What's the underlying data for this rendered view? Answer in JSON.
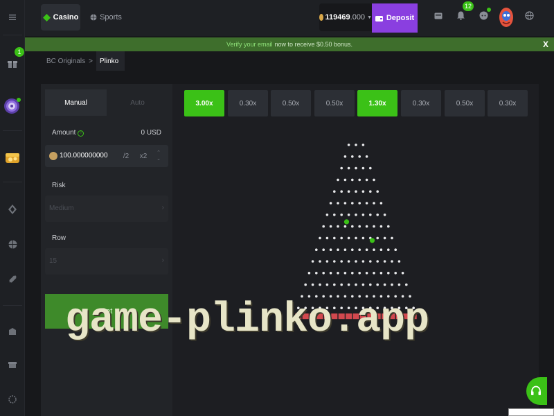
{
  "topbar": {
    "casino_label": "Casino",
    "sports_label": "Sports",
    "balance_main": "119469",
    "balance_decimal": ".000",
    "deposit_label": "Deposit",
    "notification_count": "12"
  },
  "rail": {
    "gift_badge": "1"
  },
  "banner": {
    "highlight": "Verify your email",
    "text": "now to receive $0.50 bonus.",
    "close_label": "X"
  },
  "breadcrumb": {
    "root": "BC Originals",
    "separator": ">",
    "current": "Plinko"
  },
  "controls": {
    "mode_manual": "Manual",
    "mode_auto": "Auto",
    "amount_label": "Amount",
    "amount_info": "!",
    "amount_usd": "0 USD",
    "amount_value": "100.000000000",
    "half_label": "/2",
    "double_label": "x2",
    "risk_label": "Risk",
    "risk_value": "Medium",
    "row_label": "Row",
    "row_value": "15",
    "bet_label": "Bet"
  },
  "multipliers": [
    {
      "label": "3.00x",
      "active": true
    },
    {
      "label": "0.30x",
      "active": false
    },
    {
      "label": "0.50x",
      "active": false
    },
    {
      "label": "0.50x",
      "active": false
    },
    {
      "label": "1.30x",
      "active": true
    },
    {
      "label": "0.30x",
      "active": false
    },
    {
      "label": "0.50x",
      "active": false
    },
    {
      "label": "0.30x",
      "active": false
    }
  ],
  "board": {
    "rows": 15,
    "first_row_pins": 3,
    "balls": 2
  },
  "watermark": "game-plinko.app",
  "colors": {
    "accent_green": "#3bc117",
    "deposit_purple": "#8a3fe0",
    "banner_green": "#3e6e2c",
    "bucket_red": "#d2484e",
    "background": "#17181b"
  },
  "icons": {
    "menu": "menu-icon",
    "casino": "casino-icon",
    "sports": "sports-icon",
    "wallet": "wallet-icon",
    "bell": "bell-icon",
    "chat": "chat-icon",
    "globe": "globe-icon",
    "support": "headset-icon"
  }
}
